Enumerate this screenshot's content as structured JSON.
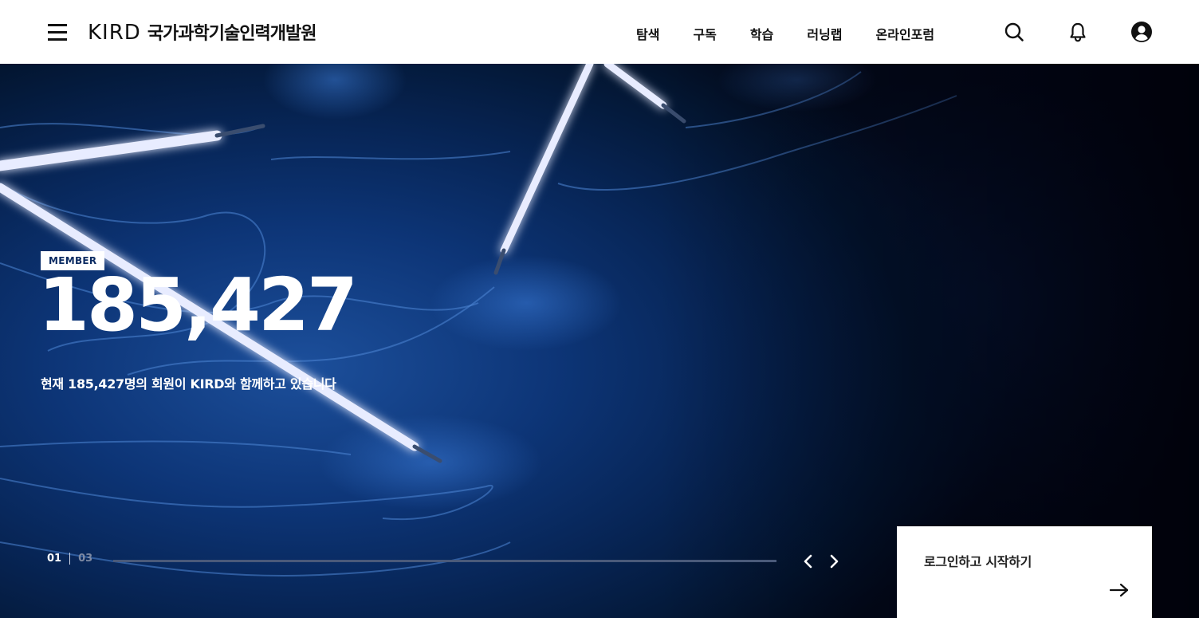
{
  "header": {
    "logo_mark": "KIRD",
    "logo_text": "국가과학기술인력개발원",
    "nav": [
      "탐색",
      "구독",
      "학습",
      "러닝랩",
      "온라인포럼"
    ],
    "icons": {
      "menu": "hamburger-menu-icon",
      "search": "search-icon",
      "bell": "bell-icon",
      "user": "user-circle-icon"
    }
  },
  "hero": {
    "badge": "MEMBER",
    "count": "185,427",
    "description": "현재 185,427명의 회원이 KIRD와 함께하고 있습니다",
    "pager": {
      "current": "01",
      "total": "03"
    },
    "progress": 0,
    "accent_color": "#0c2c63"
  },
  "login_card": {
    "label": "로그인하고 시작하기"
  }
}
